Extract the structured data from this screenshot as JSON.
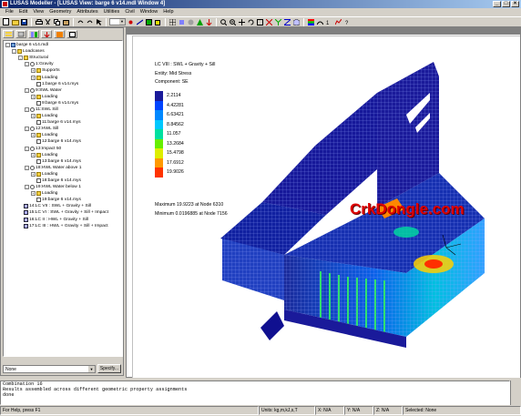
{
  "window": {
    "title": "LUSAS Modeller  - [LUSAS View: barge 6 v14.mdl Window 4]",
    "controls": [
      "_",
      "□",
      "×"
    ]
  },
  "menubar": [
    "File",
    "Edit",
    "View",
    "Geometry",
    "Attributes",
    "Utilities",
    "Civil",
    "Window",
    "Help"
  ],
  "tree": {
    "nodes": [
      {
        "label": "barge 6 v14.mdl",
        "indent": 0,
        "icon": "db",
        "exp": "-"
      },
      {
        "label": "Loadcases",
        "indent": 1,
        "icon": "folder",
        "exp": "-"
      },
      {
        "label": "Structural",
        "indent": 2,
        "icon": "folder",
        "exp": "-"
      },
      {
        "label": "1:Gravity",
        "indent": 3,
        "icon": "loadcase",
        "exp": "-"
      },
      {
        "label": "Supports",
        "indent": 4,
        "icon": "folder",
        "exp": "+"
      },
      {
        "label": "Loading",
        "indent": 4,
        "icon": "folder",
        "exp": "+"
      },
      {
        "label": "1:barge 6 v14.mys",
        "indent": 4,
        "icon": "doc",
        "exp": ""
      },
      {
        "label": "9:SWL Water",
        "indent": 3,
        "icon": "loadcase",
        "exp": "-"
      },
      {
        "label": "Loading",
        "indent": 4,
        "icon": "folder",
        "exp": "+"
      },
      {
        "label": "9:barge 6 v14.mys",
        "indent": 4,
        "icon": "doc",
        "exp": ""
      },
      {
        "label": "11:SWL Sill",
        "indent": 3,
        "icon": "loadcase",
        "exp": "-"
      },
      {
        "label": "Loading",
        "indent": 4,
        "icon": "folder",
        "exp": "+"
      },
      {
        "label": "11:barge 6 v14.mys",
        "indent": 4,
        "icon": "doc",
        "exp": ""
      },
      {
        "label": "12:HWL Sill",
        "indent": 3,
        "icon": "loadcase",
        "exp": "-"
      },
      {
        "label": "Loading",
        "indent": 4,
        "icon": "folder",
        "exp": "+"
      },
      {
        "label": "12:barge 6 v14.mys",
        "indent": 4,
        "icon": "doc",
        "exp": ""
      },
      {
        "label": "13:Impact 50",
        "indent": 3,
        "icon": "loadcase",
        "exp": "-"
      },
      {
        "label": "Loading",
        "indent": 4,
        "icon": "folder",
        "exp": "+"
      },
      {
        "label": "13:barge 6 v14.mys",
        "indent": 4,
        "icon": "doc",
        "exp": ""
      },
      {
        "label": "18:HWL Water above 1",
        "indent": 3,
        "icon": "loadcase",
        "exp": "-"
      },
      {
        "label": "Loading",
        "indent": 4,
        "icon": "folder",
        "exp": "+"
      },
      {
        "label": "18:barge 6 v14.mys",
        "indent": 4,
        "icon": "doc",
        "exp": ""
      },
      {
        "label": "19:HWL Water below 1",
        "indent": 3,
        "icon": "loadcase",
        "exp": "-"
      },
      {
        "label": "Loading",
        "indent": 4,
        "icon": "folder",
        "exp": "+"
      },
      {
        "label": "19:barge 6 v14.mys",
        "indent": 4,
        "icon": "doc",
        "exp": ""
      },
      {
        "label": "14:LC VII : SWL + Gravity + Sill",
        "indent": 2,
        "icon": "combo",
        "exp": ""
      },
      {
        "label": "15:LC VI : SWL + Gravity + Sill + Impact",
        "indent": 2,
        "icon": "combo",
        "exp": ""
      },
      {
        "label": "16:LC II : HWL + Gravity + Sill",
        "indent": 2,
        "icon": "combo",
        "exp": ""
      },
      {
        "label": "17:LC III : HWL + Gravity + Sill + Impact",
        "indent": 2,
        "icon": "combo",
        "exp": ""
      }
    ]
  },
  "bottom": {
    "select_value": "None",
    "specify_label": "Specify..."
  },
  "legend": {
    "lines": [
      "LC VIII : SWL + Gravity + Sill",
      "Entity: Mid Stress",
      "Component: SE"
    ],
    "values": [
      "2.2114",
      "4.42281",
      "6.63421",
      "8.84562",
      "11.057",
      "13.2684",
      "15.4798",
      "17.6912",
      "19.9026"
    ],
    "colors": [
      "#1a1a9a",
      "#0044ff",
      "#0088ff",
      "#00c8ff",
      "#00e0a0",
      "#66ee00",
      "#ddee00",
      "#ff9900",
      "#ff3300"
    ],
    "maximum": "Maximum  19.9223    at Node 6310",
    "minimum": "Minimum  0.0196885    at Node 7156"
  },
  "watermark": "CrkDongle.com",
  "command": {
    "lines": [
      "Combination 16",
      "Results assembled across different geometric property assignments",
      "    done"
    ]
  },
  "status": {
    "help": "For Help, press F1",
    "units": "Units: kg,m,kJ,s,T",
    "x": "X: N/A",
    "y": "Y: N/A",
    "z": "Z: N/A",
    "selected": "Selected: None"
  }
}
